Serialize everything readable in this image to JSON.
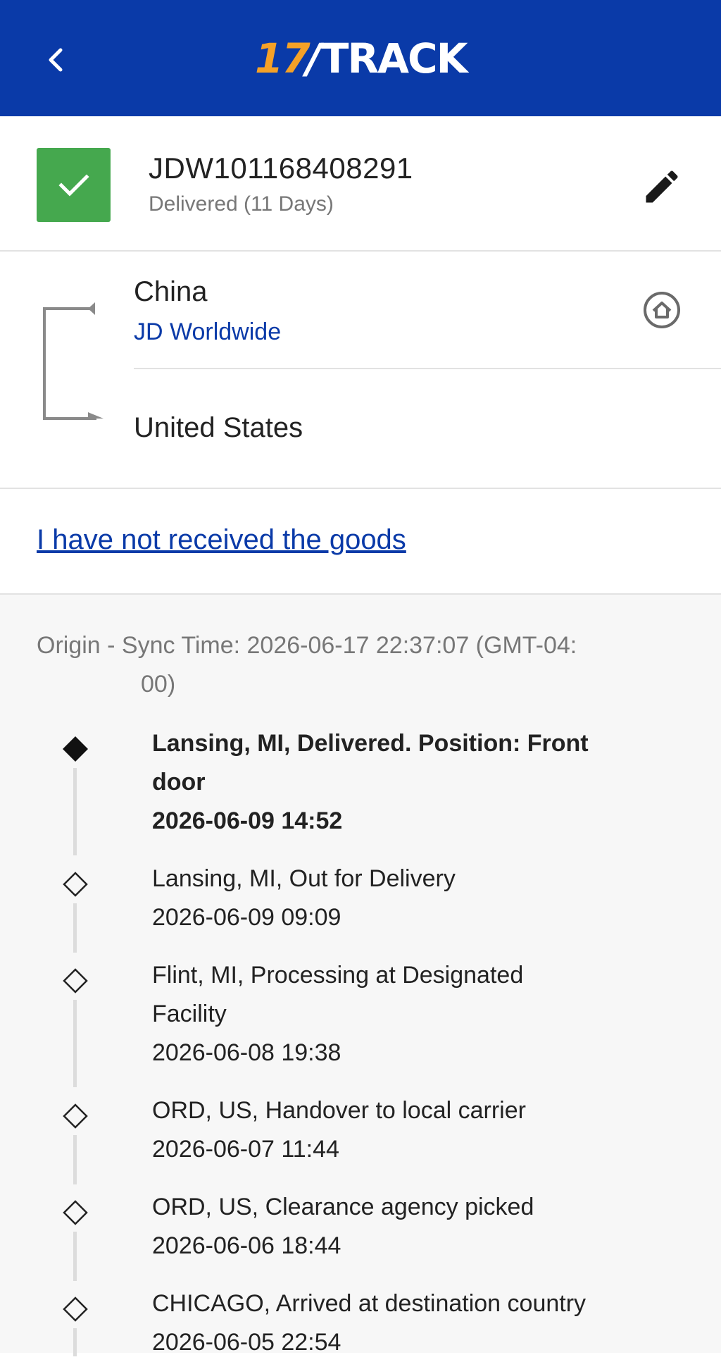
{
  "header": {
    "logo_number": "17",
    "logo_word": "TRACK"
  },
  "package": {
    "tracking_number": "JDW101168408291",
    "status_text": "Delivered (11 Days)",
    "status_color": "#45a84e"
  },
  "route": {
    "origin_country": "China",
    "carrier": "JD Worldwide",
    "destination_country": "United States"
  },
  "actions": {
    "not_received_link": "I have not received the goods"
  },
  "events": {
    "sync_label": "Origin - Sync Time: 2026-06-17 22:37:07 (GMT-04:",
    "sync_label_cont": "00)",
    "items": [
      {
        "desc_line1": "Lansing, MI, Delivered. Position: Front",
        "desc_line2": "door",
        "time": "2026-06-09 14:52",
        "current": true
      },
      {
        "desc_line1": "Lansing, MI, Out for Delivery",
        "desc_line2": "",
        "time": "2026-06-09 09:09",
        "current": false
      },
      {
        "desc_line1": "Flint, MI, Processing at Designated",
        "desc_line2": "Facility",
        "time": "2026-06-08 19:38",
        "current": false
      },
      {
        "desc_line1": "ORD, US, Handover to local carrier",
        "desc_line2": "",
        "time": "2026-06-07 11:44",
        "current": false
      },
      {
        "desc_line1": "ORD, US, Clearance agency picked",
        "desc_line2": "",
        "time": "2026-06-06 18:44",
        "current": false
      },
      {
        "desc_line1": "CHICAGO, Arrived at destination country",
        "desc_line2": "",
        "time": "2026-06-05 22:54",
        "current": false
      }
    ]
  },
  "colors": {
    "header_bg": "#0a3aa8",
    "logo_accent": "#f5a127",
    "link": "#0a3aa8"
  },
  "icons": [
    "back-chevron-icon",
    "checkmark-icon",
    "pencil-icon",
    "route-arrow-icon",
    "home-circle-icon",
    "filled-diamond-icon",
    "hollow-diamond-icon"
  ]
}
